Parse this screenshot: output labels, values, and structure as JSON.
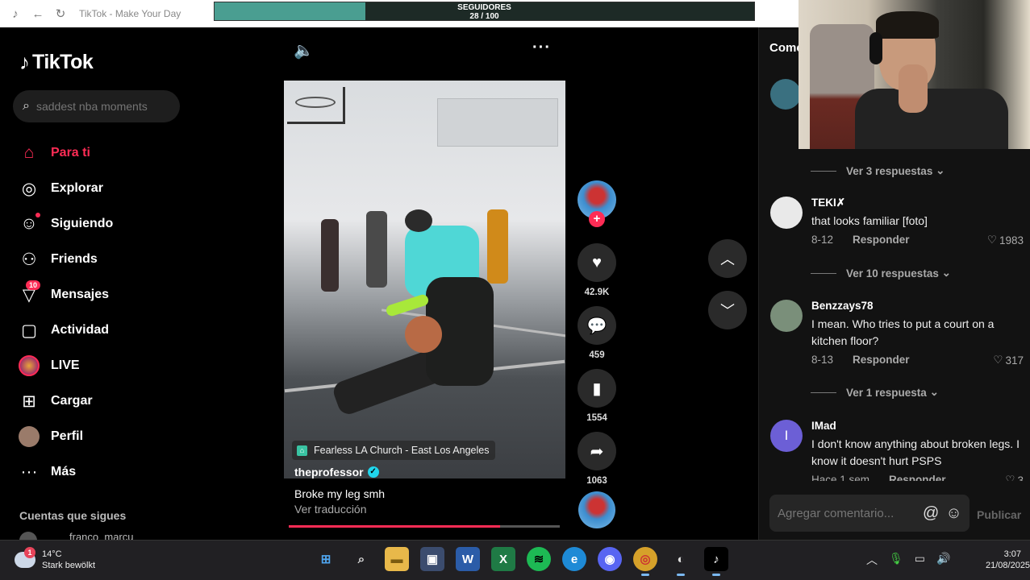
{
  "browser": {
    "title": "TikTok - Make Your Day",
    "followers_label": "SEGUIDORES",
    "followers_count": "28 / 100",
    "followers_progress": 0.28
  },
  "sidebar": {
    "logo_text": "TikTok",
    "search_placeholder": "saddest nba moments",
    "items": [
      {
        "label": "Para ti",
        "icon": "home-icon"
      },
      {
        "label": "Explorar",
        "icon": "compass-icon"
      },
      {
        "label": "Siguiendo",
        "icon": "user-plus-icon"
      },
      {
        "label": "Friends",
        "icon": "friends-icon"
      },
      {
        "label": "Mensajes",
        "icon": "send-icon",
        "badge": "10"
      },
      {
        "label": "Actividad",
        "icon": "activity-icon"
      },
      {
        "label": "LIVE",
        "icon": "live-icon"
      },
      {
        "label": "Cargar",
        "icon": "upload-icon"
      },
      {
        "label": "Perfil",
        "icon": "profile-avatar"
      },
      {
        "label": "Más",
        "icon": "more-icon"
      }
    ],
    "following_title": "Cuentas que sigues",
    "following_first": "franco_marcu"
  },
  "video": {
    "location": "Fearless LA Church - East Los Angeles",
    "author": "theprofessor",
    "caption": "Broke my leg smh",
    "translate": "Ver traducción",
    "progress": 0.78,
    "likes": "42.9K",
    "comments": "459",
    "saves": "1554",
    "shares": "1063"
  },
  "comments": {
    "title": "Comentarios",
    "input_placeholder": "Agregar comentario...",
    "publish": "Publicar",
    "replies_1": "Ver 3 respuestas",
    "replies_2": "Ver 10 respuestas",
    "replies_3": "Ver 1 respuesta",
    "reply_label": "Responder",
    "list": [
      {
        "user": "TEKI✗",
        "text": "that looks familiar [foto]",
        "date": "8-12",
        "likes": "1983",
        "avatar_color": "#e9e9e9"
      },
      {
        "user": "Benzzays78",
        "text": "I mean. Who tries to put a court on a kitchen floor?",
        "date": "8-13",
        "likes": "317",
        "avatar_color": "#7a8f7a"
      },
      {
        "user": "IMad",
        "text": "I don't know anything about broken legs. I know it doesn't hurt PSPS",
        "date": "Hace 1 sem",
        "likes": "3",
        "avatar_color": "#6c5fd6",
        "avatar_letter": "I"
      }
    ]
  },
  "taskbar": {
    "temp": "14°C",
    "weather": "Stark bewölkt",
    "weather_badge": "1",
    "time": "3:07",
    "date": "21/08/2025"
  }
}
